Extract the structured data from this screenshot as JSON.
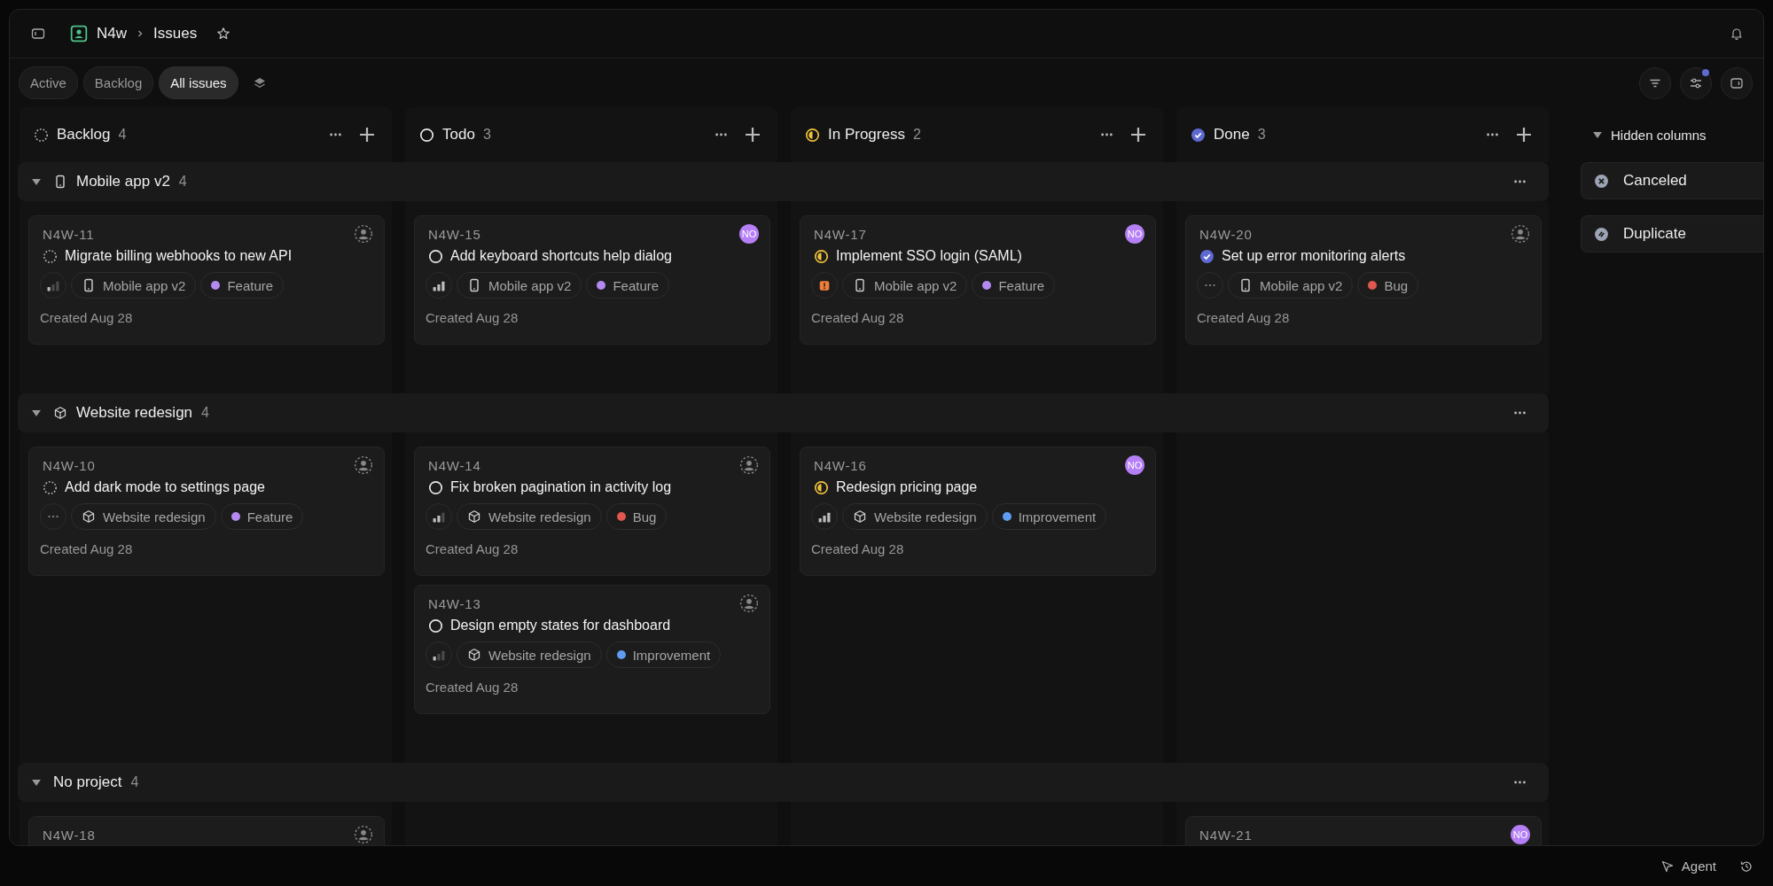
{
  "topbar": {
    "team": "N4w",
    "page": "Issues"
  },
  "view_tabs": [
    {
      "label": "Active",
      "selected": false
    },
    {
      "label": "Backlog",
      "selected": false
    },
    {
      "label": "All issues",
      "selected": true
    }
  ],
  "display_options": {
    "modified": true
  },
  "columns": [
    {
      "name": "Backlog",
      "count": "4",
      "kind": "backlog"
    },
    {
      "name": "Todo",
      "count": "3",
      "kind": "todo"
    },
    {
      "name": "In Progress",
      "count": "2",
      "kind": "in_progress"
    },
    {
      "name": "Done",
      "count": "3",
      "kind": "done"
    }
  ],
  "groups": [
    {
      "name": "Mobile app v2",
      "kind": "phone",
      "count": "4",
      "expanded": true,
      "cells": [
        [
          {
            "id": "N4W-11",
            "title": "Migrate billing webhooks to new API",
            "status": {
              "kind": "backlog"
            },
            "priority": {
              "kind": "low"
            },
            "project": {
              "name": "Mobile app v2",
              "kind": "phone"
            },
            "label": {
              "name": "Feature",
              "color": "#b48af0"
            },
            "created": "Created Aug 28"
          }
        ],
        [
          {
            "id": "N4W-15",
            "title": "Add keyboard shortcuts help dialog",
            "status": {
              "kind": "todo"
            },
            "priority": {
              "kind": "high"
            },
            "project": {
              "name": "Mobile app v2",
              "kind": "phone"
            },
            "label": {
              "name": "Feature",
              "color": "#b48af0"
            },
            "created": "Created Aug 28",
            "assignee": {
              "initials": "NO"
            }
          }
        ],
        [
          {
            "id": "N4W-17",
            "title": "Implement SSO login (SAML)",
            "status": {
              "kind": "in_progress"
            },
            "priority": {
              "kind": "urgent"
            },
            "project": {
              "name": "Mobile app v2",
              "kind": "phone"
            },
            "label": {
              "name": "Feature",
              "color": "#b48af0"
            },
            "created": "Created Aug 28",
            "assignee": {
              "initials": "NO"
            }
          }
        ],
        [
          {
            "id": "N4W-20",
            "title": "Set up error monitoring alerts",
            "status": {
              "kind": "done"
            },
            "priority": {
              "kind": "none"
            },
            "project": {
              "name": "Mobile app v2",
              "kind": "phone"
            },
            "label": {
              "name": "Bug",
              "color": "#e0574f"
            },
            "created": "Created Aug 28"
          }
        ]
      ]
    },
    {
      "name": "Website redesign",
      "kind": "cube",
      "count": "4",
      "expanded": true,
      "cells": [
        [
          {
            "id": "N4W-10",
            "title": "Add dark mode to settings page",
            "status": {
              "kind": "backlog"
            },
            "priority": {
              "kind": "none"
            },
            "project": {
              "name": "Website redesign",
              "kind": "cube"
            },
            "label": {
              "name": "Feature",
              "color": "#b48af0"
            },
            "created": "Created Aug 28"
          }
        ],
        [
          {
            "id": "N4W-14",
            "title": "Fix broken pagination in activity log",
            "status": {
              "kind": "todo"
            },
            "priority": {
              "kind": "medium"
            },
            "project": {
              "name": "Website redesign",
              "kind": "cube"
            },
            "label": {
              "name": "Bug",
              "color": "#e0574f"
            },
            "created": "Created Aug 28"
          },
          {
            "id": "N4W-13",
            "title": "Design empty states for dashboard",
            "status": {
              "kind": "todo"
            },
            "priority": {
              "kind": "low"
            },
            "project": {
              "name": "Website redesign",
              "kind": "cube"
            },
            "label": {
              "name": "Improvement",
              "color": "#5f9bf0"
            },
            "created": "Created Aug 28"
          }
        ],
        [
          {
            "id": "N4W-16",
            "title": "Redesign pricing page",
            "status": {
              "kind": "in_progress"
            },
            "priority": {
              "kind": "high"
            },
            "project": {
              "name": "Website redesign",
              "kind": "cube"
            },
            "label": {
              "name": "Improvement",
              "color": "#5f9bf0"
            },
            "created": "Created Aug 28",
            "assignee": {
              "initials": "NO"
            }
          }
        ],
        []
      ]
    },
    {
      "name": "No project",
      "kind": "none",
      "count": "4",
      "expanded": true,
      "cells": [
        [
          {
            "id": "N4W-18"
          }
        ],
        [],
        [],
        [
          {
            "id": "N4W-21",
            "assignee": {
              "initials": "NO"
            }
          }
        ]
      ]
    }
  ],
  "hidden_columns": {
    "label": "Hidden columns",
    "expanded": true,
    "items": [
      {
        "name": "Canceled",
        "kind": "canceled"
      },
      {
        "name": "Duplicate",
        "kind": "duplicate"
      }
    ]
  },
  "footer": {
    "agent": "Agent"
  }
}
